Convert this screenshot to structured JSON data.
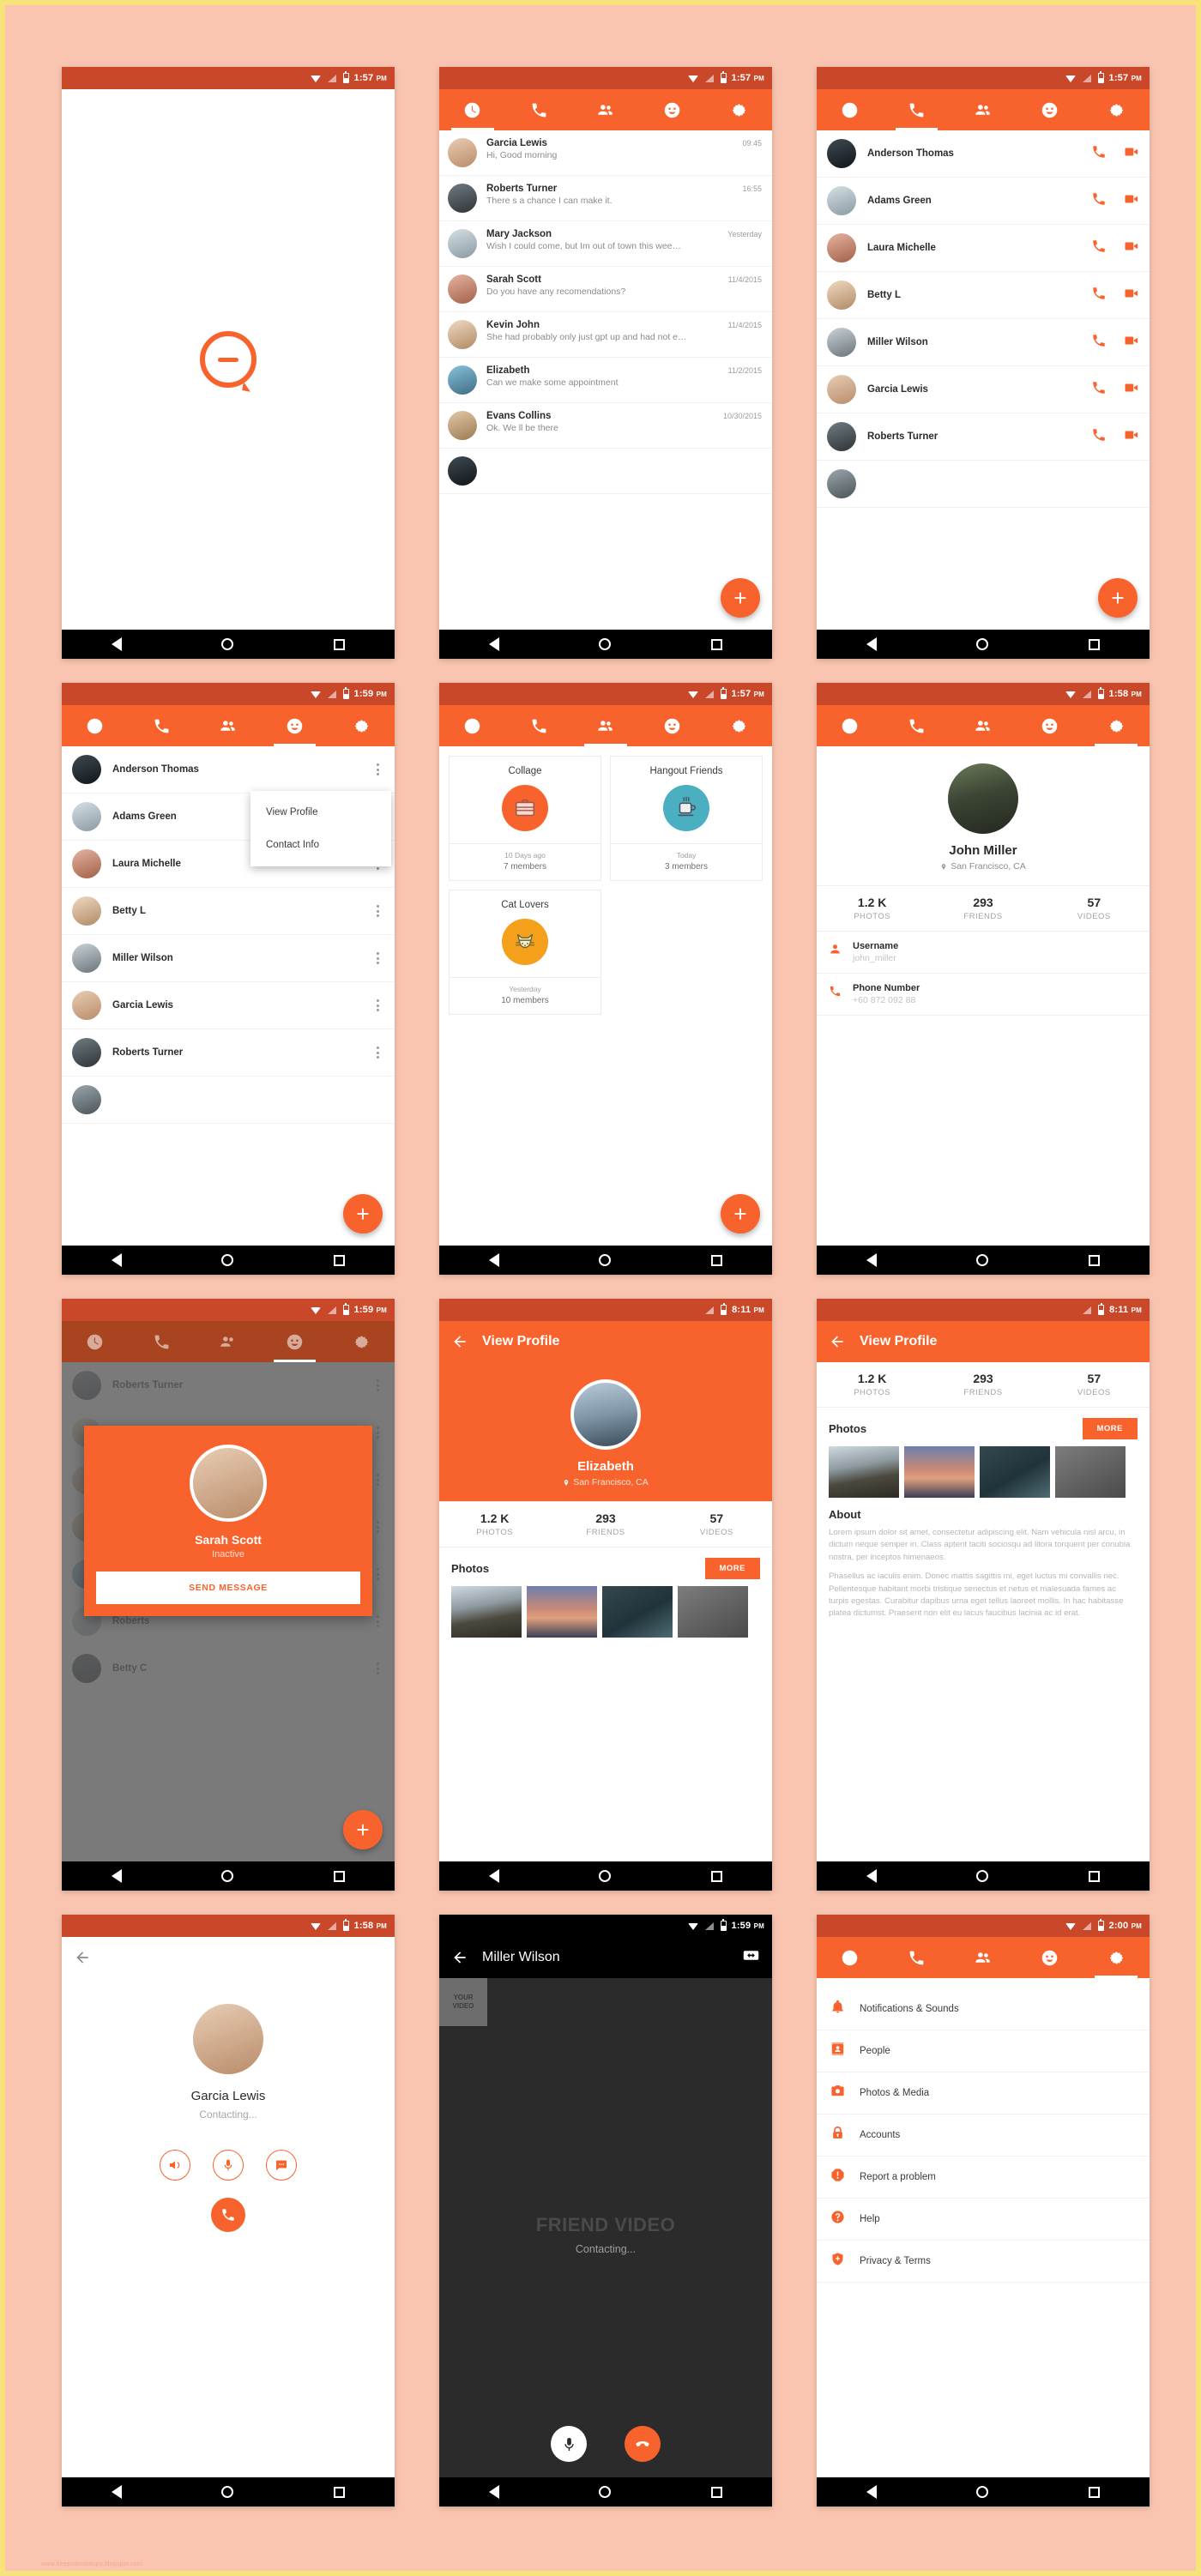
{
  "statusbar": {
    "time_157": "1:57",
    "time_158": "1:58",
    "time_159": "1:59",
    "time_200": "2:00",
    "time_811": "8:11",
    "meridiem": "PM"
  },
  "tabs": [
    {
      "name": "recents",
      "icon": "clock-icon"
    },
    {
      "name": "calls",
      "icon": "phone-icon"
    },
    {
      "name": "groups",
      "icon": "people-icon"
    },
    {
      "name": "stickers",
      "icon": "smiley-icon"
    },
    {
      "name": "settings",
      "icon": "gear-icon"
    }
  ],
  "colors": {
    "accent": "#f8632d",
    "status_dark": "#c9482a",
    "nav_black": "#000000"
  },
  "chats": {
    "items": [
      {
        "name": "Garcia Lewis",
        "message": "Hi, Good morning",
        "time": "09:45"
      },
      {
        "name": "Roberts Turner",
        "message": "There s a chance I can make it.",
        "time": "16:55"
      },
      {
        "name": "Mary Jackson",
        "message": "Wish I could come, but Im out of town this wee…",
        "time": "Yesterday"
      },
      {
        "name": "Sarah Scott",
        "message": "Do you have any recomendations?",
        "time": "11/4/2015"
      },
      {
        "name": "Kevin John",
        "message": "She had probably only just gpt up and had not e…",
        "time": "11/4/2015"
      },
      {
        "name": "Elizabeth",
        "message": "Can we make some appointment",
        "time": "11/2/2015"
      },
      {
        "name": "Evans Collins",
        "message": "Ok. We ll be there",
        "time": "10/30/2015"
      }
    ],
    "fab_label": "+"
  },
  "calls": {
    "contacts": [
      "Anderson Thomas",
      "Adams Green",
      "Laura Michelle",
      "Betty L",
      "Miller Wilson",
      "Garcia Lewis",
      "Roberts Turner"
    ],
    "action_call": "phone-icon",
    "action_video": "video-icon",
    "fab_label": "+"
  },
  "people": {
    "contacts": [
      "Anderson Thomas",
      "Adams Green",
      "Laura Michelle",
      "Betty L",
      "Miller Wilson",
      "Garcia Lewis",
      "Roberts Turner"
    ],
    "menu": {
      "view_profile": "View Profile",
      "contact_info": "Contact Info"
    },
    "fab_label": "+"
  },
  "groups": {
    "items": [
      {
        "title": "Collage",
        "when": "10 Days ago",
        "members": "7 members",
        "icon": "briefcase-icon",
        "color": "#f8632d"
      },
      {
        "title": "Hangout Friends",
        "when": "Today",
        "members": "3 members",
        "icon": "coffee-cup-icon",
        "color": "#4aafc0"
      },
      {
        "title": "Cat Lovers",
        "when": "Yesterday",
        "members": "10 members",
        "icon": "cat-icon",
        "color": "#f5a01b"
      }
    ],
    "fab_label": "+"
  },
  "profile_self": {
    "name": "John Miller",
    "location": "San Francisco, CA",
    "stats": [
      {
        "num": "1.2 K",
        "label": "PHOTOS"
      },
      {
        "num": "293",
        "label": "FRIENDS"
      },
      {
        "num": "57",
        "label": "VIDEOS"
      }
    ],
    "info": [
      {
        "label": "Username",
        "value": "john_miller",
        "icon": "person-icon"
      },
      {
        "label": "Phone Number",
        "value": "+60 872 092 88",
        "icon": "phone-icon"
      }
    ]
  },
  "view_profile": {
    "title": "View Profile",
    "name": "Elizabeth",
    "location": "San Francisco, CA",
    "stats": [
      {
        "num": "1.2 K",
        "label": "PHOTOS"
      },
      {
        "num": "293",
        "label": "FRIENDS"
      },
      {
        "num": "57",
        "label": "VIDEOS"
      }
    ],
    "photos_title": "Photos",
    "more_label": "MORE",
    "about_title": "About",
    "about_p1": "Lorem ipsum dolor sit amet, consectetur adipiscing elit. Nam vehicula nisl arcu, in dictum neque semper in. Class aptent taciti sociosqu ad litora torquent per conubia nostra, per inceptos himenaeos.",
    "about_p2": "Phasellus ac iaculis enim. Donec mattis sagittis mi, eget luctus mi convallis nec. Pellentesque habitant morbi tristique senectus et netus et malesuada fames ac turpis egestas. Curabitur dapibus urna eget tellus laoreet mollis. In hac habitasse platea dictumst. Praesent non elit eu lacus faucibus lacinia ac id erat."
  },
  "contact_dialog": {
    "name": "Sarah Scott",
    "status": "Inactive",
    "button": "SEND MESSAGE",
    "behind_top": "Roberts Turner",
    "behind_a": "Roberts",
    "behind_b": "Betty C"
  },
  "voice_call": {
    "name": "Garcia Lewis",
    "status": "Contacting...",
    "actions": [
      "speaker-icon",
      "mic-icon",
      "message-icon"
    ],
    "end_action": "phone-icon"
  },
  "video_call": {
    "title": "Miller Wilson",
    "self_label_line1": "YOUR",
    "self_label_line2": "VIDEO",
    "remote_label": "FRIEND VIDEO",
    "status": "Contacting...",
    "swap_icon": "camera-swap-icon",
    "mic_icon": "mic-icon",
    "hangup_icon": "hangup-icon"
  },
  "settings": {
    "items": [
      {
        "label": "Notifications & Sounds",
        "icon": "bell-icon"
      },
      {
        "label": "People",
        "icon": "contact-card-icon"
      },
      {
        "label": "Photos & Media",
        "icon": "camera-icon"
      },
      {
        "label": "Accounts",
        "icon": "lock-icon"
      },
      {
        "label": "Report a problem",
        "icon": "alert-icon"
      },
      {
        "label": "Help",
        "icon": "help-icon"
      },
      {
        "label": "Privacy & Terms",
        "icon": "shield-icon"
      }
    ]
  },
  "navbar": {
    "back": "back-triangle-icon",
    "home": "home-circle-icon",
    "recents": "recents-square-icon"
  },
  "credit": "www.freepsdmockups.blogspot.com"
}
